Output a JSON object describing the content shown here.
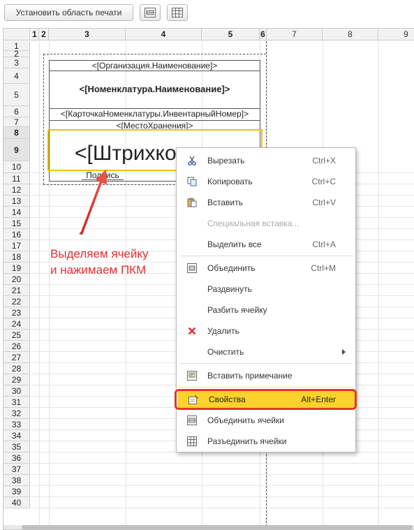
{
  "toolbar": {
    "print_area_label": "Установить область печати",
    "merge_icon": "merge-cells-icon",
    "split_icon": "split-cells-icon"
  },
  "columns": [
    "1",
    "2",
    "3",
    "4",
    "5",
    "6",
    "7",
    "8",
    "9"
  ],
  "rows": [
    "1",
    "2",
    "3",
    "4",
    "5",
    "6",
    "7",
    "8",
    "9",
    "10",
    "11",
    "12",
    "13",
    "14",
    "15",
    "16",
    "17",
    "18",
    "19",
    "20",
    "21",
    "22",
    "23",
    "24",
    "25",
    "26",
    "27",
    "28",
    "29",
    "30",
    "31",
    "32",
    "33",
    "34",
    "35",
    "36",
    "37",
    "38",
    "39",
    "40"
  ],
  "form": {
    "organization": "<[Организация.Наименование]>",
    "nomenclature": "<[Номенклатура.Наименование]>",
    "inventory_number": "<[КарточкаНоменклатуры.ИнвентарныйНомер]>",
    "storage_place": "<[МестоХранения]>",
    "barcode": "<[Штрихкод]>",
    "signature": "Подпись"
  },
  "annotation": {
    "line1": "Выделяем ячейку",
    "line2": "и нажимаем ПКМ",
    "color": "#e03030"
  },
  "context_menu": {
    "items": [
      {
        "label": "Вырезать",
        "shortcut": "Ctrl+X",
        "icon": "scissors-icon"
      },
      {
        "label": "Копировать",
        "shortcut": "Ctrl+C",
        "icon": "copy-icon"
      },
      {
        "label": "Вставить",
        "shortcut": "Ctrl+V",
        "icon": "paste-icon"
      },
      {
        "label": "Специальная вставка...",
        "shortcut": "",
        "icon": ""
      },
      {
        "label": "Выделить все",
        "shortcut": "Ctrl+A",
        "icon": ""
      },
      {
        "label": "Объединить",
        "shortcut": "Ctrl+M",
        "icon": "merge-icon"
      },
      {
        "label": "Раздвинуть",
        "shortcut": "",
        "icon": ""
      },
      {
        "label": "Разбить ячейку",
        "shortcut": "",
        "icon": ""
      },
      {
        "label": "Удалить",
        "shortcut": "",
        "icon": "delete-x-icon"
      },
      {
        "label": "Очистить",
        "shortcut": "",
        "icon": ""
      },
      {
        "label": "Вставить примечание",
        "shortcut": "",
        "icon": "note-icon"
      },
      {
        "label": "Свойства",
        "shortcut": "Alt+Enter",
        "icon": "properties-icon"
      },
      {
        "label": "Объединить ячейки",
        "shortcut": "",
        "icon": "merge-cells-icon"
      },
      {
        "label": "Разъединить ячейки",
        "shortcut": "",
        "icon": "split-cells-icon"
      }
    ],
    "highlight_color": "#e53624",
    "active_color": "#fad22c"
  }
}
